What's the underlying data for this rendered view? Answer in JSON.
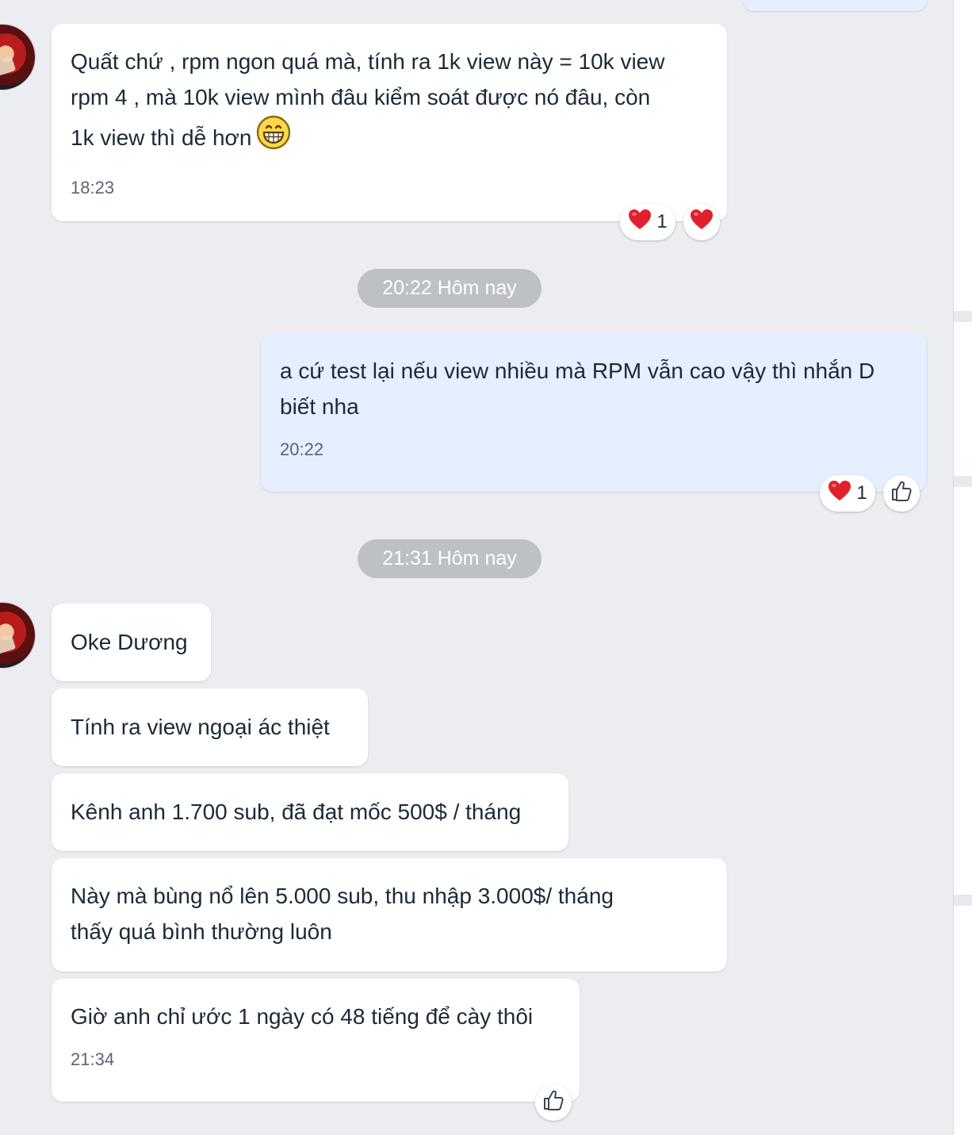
{
  "messages": {
    "m1": {
      "lines": [
        "Quất chứ , rpm ngon quá mà, tính ra 1k view này = 10k view",
        "rpm 4 , mà 10k view mình đâu kiểm soát được nó đâu, còn",
        "1k view thì dễ hơn"
      ],
      "emoji": "grinning-face-emoji",
      "time": "18:23",
      "reaction_count": "1"
    },
    "sep1": "20:22 Hôm nay",
    "m2": {
      "lines": [
        "a cứ test lại nếu view nhiều mà RPM vẫn cao vậy thì nhắn D",
        "biết nha"
      ],
      "time": "20:22",
      "reaction_count": "1"
    },
    "sep2": "21:31 Hôm nay",
    "m3": "Oke Dương",
    "m4": "Tính ra view ngoại ác thiệt",
    "m5": "Kênh anh 1.700 sub, đã đạt mốc 500$ / tháng",
    "m6": {
      "lines": [
        "Này mà bùng nổ lên 5.000 sub, thu nhập 3.000$/ tháng",
        "thấy quá bình thường luôn"
      ]
    },
    "m7": {
      "text": "Giờ anh chỉ ước 1 ngày có 48 tiếng để cày thôi",
      "time": "21:34"
    }
  },
  "colors": {
    "background": "#ebedf0",
    "incoming_bubble": "#ffffff",
    "outgoing_bubble": "#e5efff",
    "time_pill": "#bdc1c6",
    "heart": "#e0202c"
  },
  "icons": {
    "reaction_heart": "heart-icon",
    "reaction_like": "thumbs-up-icon"
  }
}
